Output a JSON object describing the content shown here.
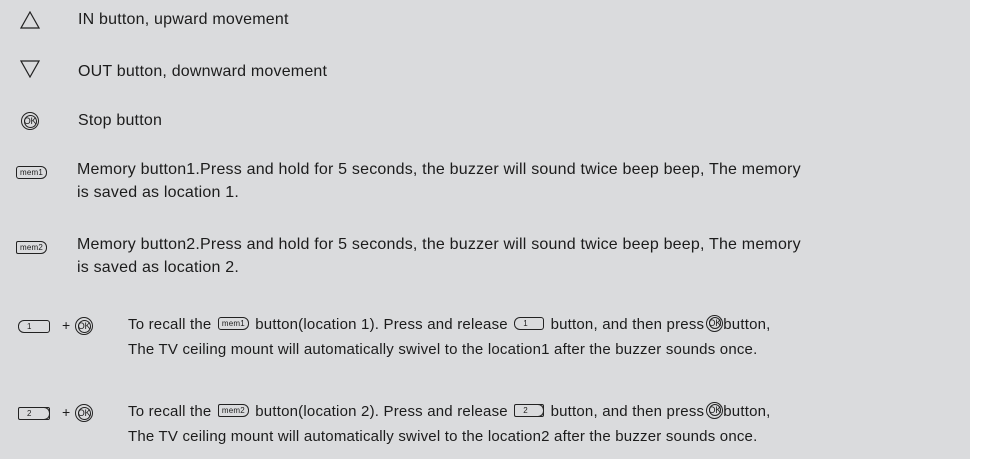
{
  "rows": {
    "in": {
      "icon": "up-triangle-outline-icon",
      "text": "IN button,  upward movement"
    },
    "out": {
      "icon": "down-triangle-outline-icon",
      "text": "OUT button, downward movement"
    },
    "stop": {
      "icon_label": "OK",
      "text": "Stop button"
    },
    "mem1": {
      "icon_label": "mem1",
      "line1": "Memory button1.Press and hold for 5 seconds, the buzzer will sound twice beep beep, The memory",
      "line2": "is saved as location 1."
    },
    "mem2": {
      "icon_label": "mem2",
      "line1": "Memory button2.Press and hold for 5 seconds, the buzzer will sound twice beep beep, The memory",
      "line2": "is saved as location 2."
    },
    "recall1": {
      "key_label": "1",
      "plus": "+",
      "ok_label": "OK",
      "mem_label": "mem1",
      "l1_a": "To recall the",
      "l1_b": "button(location 1). Press and release",
      "l1_c": "button, and then press",
      "l1_d": "button,",
      "line2": "The TV ceiling mount will automatically swivel to the location1 after the buzzer sounds once."
    },
    "recall2": {
      "key_label": "2",
      "plus": "+",
      "ok_label": "OK",
      "mem_label": "mem2",
      "l1_a": "To recall the",
      "l1_b": "button(location 2). Press and release",
      "l1_c": "button, and then press",
      "l1_d": "button,",
      "line2": "The TV ceiling mount will automatically swivel to the location2 after the buzzer sounds once."
    }
  }
}
